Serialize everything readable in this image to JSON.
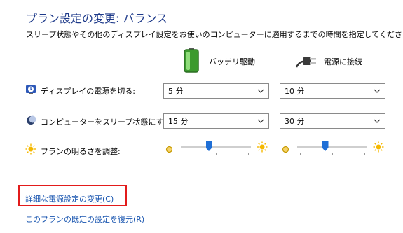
{
  "header": {
    "title": "プラン設定の変更: バランス",
    "description": "スリープ状態やその他のディスプレイ設定をお使いのコンピューターに適用するまでの時間を指定してください。"
  },
  "columns": {
    "battery": "バッテリ駆動",
    "plugged": "電源に接続"
  },
  "rows": {
    "display": {
      "label": "ディスプレイの電源を切る:",
      "battery_value": "5 分",
      "plugged_value": "10 分"
    },
    "sleep": {
      "label": "コンピューターをスリープ状態にする:",
      "battery_value": "15 分",
      "plugged_value": "30 分"
    },
    "brightness": {
      "label": "プランの明るさを調整:",
      "battery_level": 0.4,
      "plugged_level": 0.4
    }
  },
  "links": {
    "advanced": "詳細な電源設定の変更(C)",
    "restore": "このプランの既定の設定を復元(R)"
  },
  "colors": {
    "title": "#1e3a8a",
    "link": "#1a56b0",
    "highlight": "#e21b1b",
    "slider_thumb": "#1f6fd6"
  }
}
